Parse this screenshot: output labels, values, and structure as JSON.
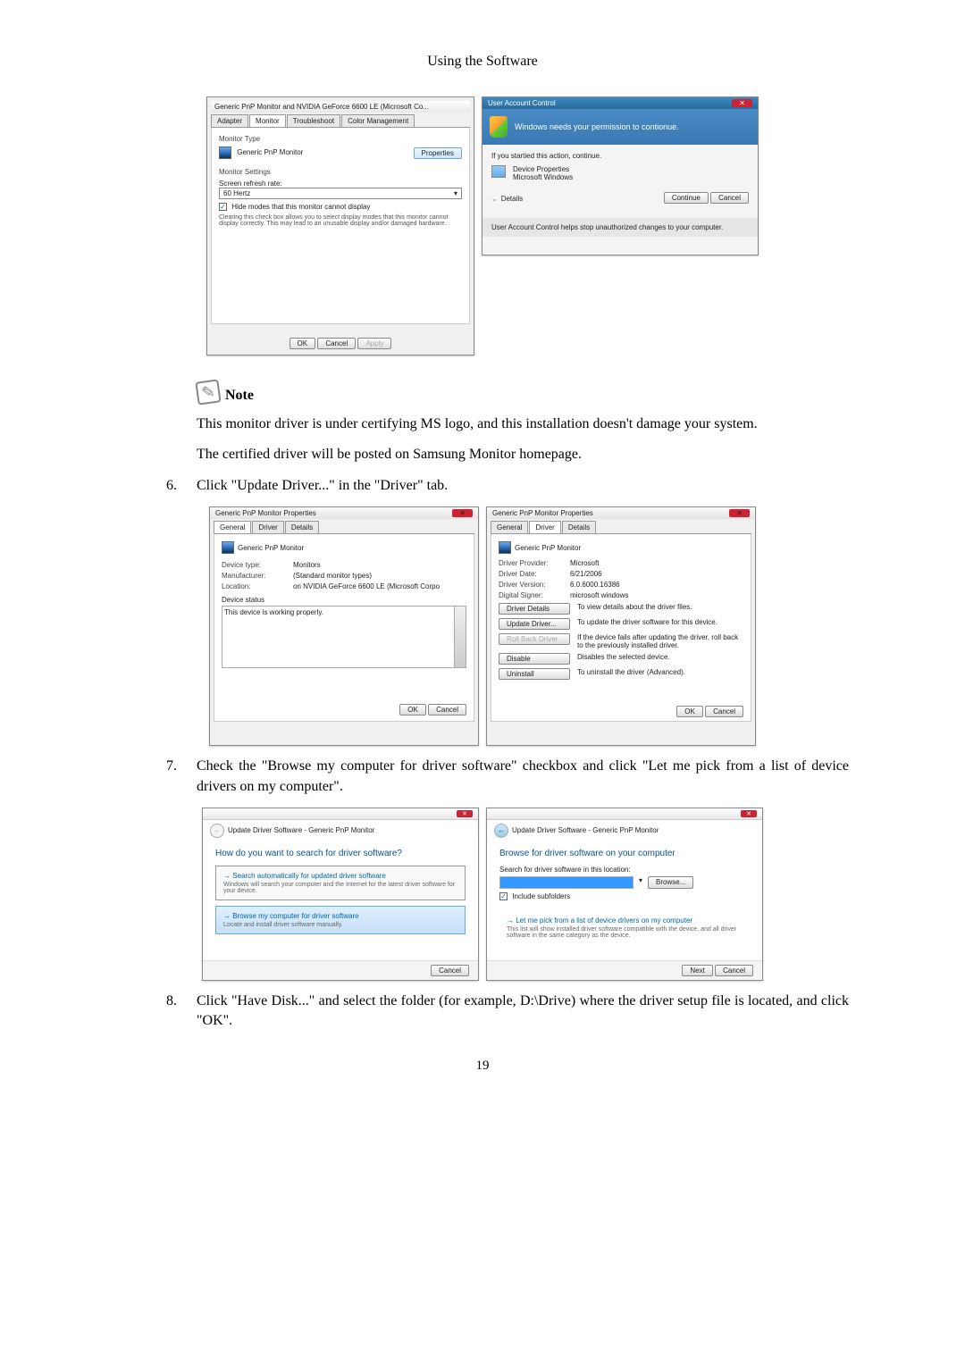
{
  "header": "Using the Software",
  "page_num": "19",
  "monitor_dialog": {
    "title": "Generic PnP Monitor and NVIDIA GeForce 6600 LE (Microsoft Co...",
    "tabs": [
      "Adapter",
      "Monitor",
      "Troubleshoot",
      "Color Management"
    ],
    "monitor_type_label": "Monitor Type",
    "monitor_name": "Generic PnP Monitor",
    "properties_btn": "Properties",
    "settings_label": "Monitor Settings",
    "refresh_label": "Screen refresh rate:",
    "refresh_value": "60 Hertz",
    "hide_modes": "Hide modes that this monitor cannot display",
    "hide_modes_desc": "Clearing this check box allows you to select display modes that this monitor cannot display correctly. This may lead to an unusable display and/or damaged hardware.",
    "ok": "OK",
    "cancel": "Cancel",
    "apply": "Apply"
  },
  "uac": {
    "title": "User Account Control",
    "banner": "Windows needs your permission to contionue.",
    "started": "If you startied this action, continue.",
    "program": "Device Properties",
    "publisher": "Microsoft Windows",
    "details": "Details",
    "continue": "Continue",
    "cancel": "Cancel",
    "footer": "User Account Control helps stop unauthorized changes to your computer."
  },
  "note": {
    "label": "Note",
    "line1": "This monitor driver is under certifying MS logo, and this installation doesn't damage your system.",
    "line2": "The certified driver will be posted on Samsung Monitor homepage."
  },
  "step6": {
    "num": "6.",
    "text": "Click \"Update Driver...\" in the \"Driver\" tab."
  },
  "props_general": {
    "title": "Generic PnP Monitor Properties",
    "tabs": [
      "General",
      "Driver",
      "Details"
    ],
    "name": "Generic PnP Monitor",
    "device_type_l": "Device type:",
    "device_type_v": "Monitors",
    "manufacturer_l": "Manufacturer:",
    "manufacturer_v": "(Standard monitor types)",
    "location_l": "Location:",
    "location_v": "on NVIDIA GeForce 6600 LE (Microsoft Corpo",
    "status_l": "Device status",
    "status_v": "This device is working properly.",
    "ok": "OK",
    "cancel": "Cancel"
  },
  "props_driver": {
    "title": "Generic PnP Monitor Properties",
    "tabs": [
      "General",
      "Driver",
      "Details"
    ],
    "name": "Generic PnP Monitor",
    "provider_l": "Driver Provider:",
    "provider_v": "Microsoft",
    "date_l": "Driver Date:",
    "date_v": "6/21/2006",
    "version_l": "Driver Version:",
    "version_v": "6.0.6000.16386",
    "signer_l": "Digital Signer:",
    "signer_v": "microsoft windows",
    "btn_details": "Driver Details",
    "desc_details": "To view details about the driver files.",
    "btn_update": "Update Driver...",
    "desc_update": "To update the driver software for this device.",
    "btn_rollback": "Roll Back Driver",
    "desc_rollback": "If the device fails after updating the driver, roll back to the previously installed driver.",
    "btn_disable": "Disable",
    "desc_disable": "Disables the selected device.",
    "btn_uninstall": "Uninstall",
    "desc_uninstall": "To uninstall the driver (Advanced).",
    "ok": "OK",
    "cancel": "Cancel"
  },
  "step7": {
    "num": "7.",
    "text": "Check the \"Browse my computer for driver software\" checkbox and click \"Let me pick from a list of device drivers on my computer\"."
  },
  "wizard1": {
    "breadcrumb": "Update Driver Software - Generic PnP Monitor",
    "heading": "How do you want to search for driver software?",
    "opt1_title": "Search automatically for updated driver software",
    "opt1_desc": "Windows will search your computer and the Internet for the latest driver software for your device.",
    "opt2_title": "Browse my computer for driver software",
    "opt2_desc": "Locate and install driver software manually.",
    "cancel": "Cancel"
  },
  "wizard2": {
    "breadcrumb": "Update Driver Software - Generic PnP Monitor",
    "heading": "Browse for driver software on your computer",
    "search_label": "Search for driver software in this location:",
    "browse": "Browse...",
    "include_sub": "Include subfolders",
    "opt_title": "Let me pick from a list of device drivers on my computer",
    "opt_desc": "This list will show installed driver software compatible with the device, and all driver software in the same category as the device.",
    "next": "Next",
    "cancel": "Cancel"
  },
  "step8": {
    "num": "8.",
    "text": "Click \"Have Disk...\" and select the folder (for example, D:\\Drive) where the driver setup file is located, and click \"OK\"."
  }
}
